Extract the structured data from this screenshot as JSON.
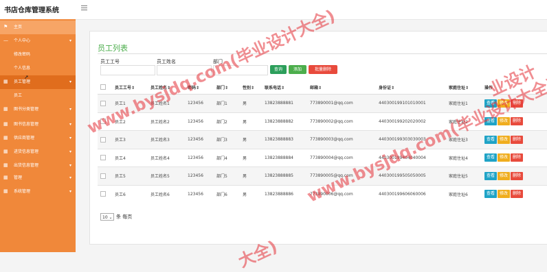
{
  "app": {
    "title": "书店仓库管理系统"
  },
  "sidebar": {
    "items": [
      {
        "label": "主页",
        "icon": "flag-icon"
      },
      {
        "label": "个人中心",
        "icon": "dash-icon"
      },
      {
        "label": "修改密码"
      },
      {
        "label": "个人信息"
      },
      {
        "label": "员工管理",
        "icon": "grid-icon"
      },
      {
        "label": "员工"
      },
      {
        "label": "图书分类管理",
        "icon": "grid-icon"
      },
      {
        "label": "图书信息管理",
        "icon": "grid-icon"
      },
      {
        "label": "供应商管理",
        "icon": "grid-icon"
      },
      {
        "label": "进货信息管理",
        "icon": "grid-icon"
      },
      {
        "label": "出货信息管理",
        "icon": "grid-icon"
      },
      {
        "label": "管理",
        "icon": "grid-icon"
      },
      {
        "label": "系统管理",
        "icon": "grid-icon"
      }
    ]
  },
  "main": {
    "title": "员工列表",
    "search": {
      "label1": "员工工号",
      "label2": "员工姓名",
      "label3": "部门",
      "value1": "",
      "value2": "",
      "value3": "",
      "search_btn": "查询",
      "add_btn": "添加",
      "batch_delete_btn": "批量删除"
    },
    "table": {
      "headers": [
        "员工工号",
        "员工姓名",
        "密码",
        "部门",
        "性别",
        "联系电话",
        "邮箱",
        "身份证",
        "家庭住址",
        "操作"
      ],
      "rows": [
        [
          "员工1",
          "员工姓名1",
          "123456",
          "部门1",
          "男",
          "13823888881",
          "773890001@qq.com",
          "440300199101010001",
          "家庭住址1"
        ],
        [
          "员工2",
          "员工姓名2",
          "123456",
          "部门2",
          "男",
          "13823888882",
          "773890002@qq.com",
          "440300199202020002",
          "家庭住址2"
        ],
        [
          "员工3",
          "员工姓名3",
          "123456",
          "部门3",
          "男",
          "13823888883",
          "773890003@qq.com",
          "440300199303030003",
          "家庭住址3"
        ],
        [
          "员工4",
          "员工姓名4",
          "123456",
          "部门4",
          "男",
          "13823888884",
          "773890004@qq.com",
          "440300199404040004",
          "家庭住址4"
        ],
        [
          "员工5",
          "员工姓名5",
          "123456",
          "部门5",
          "男",
          "13823888885",
          "773890005@qq.com",
          "440300199505050005",
          "家庭住址5"
        ],
        [
          "员工6",
          "员工姓名6",
          "123456",
          "部门6",
          "男",
          "13823888886",
          "773890006@qq.com",
          "440300199606060006",
          "家庭住址6"
        ]
      ],
      "actions": {
        "view": "查看",
        "edit": "修改",
        "delete": "删除"
      }
    },
    "pager": {
      "page_size": "10",
      "suffix": "条 每页"
    }
  },
  "watermarks": [
    "www.bysjdq.com(毕业设计大全)",
    "www.bysjdq.com(毕业设计大全)",
    "业设计",
    "大全)"
  ]
}
